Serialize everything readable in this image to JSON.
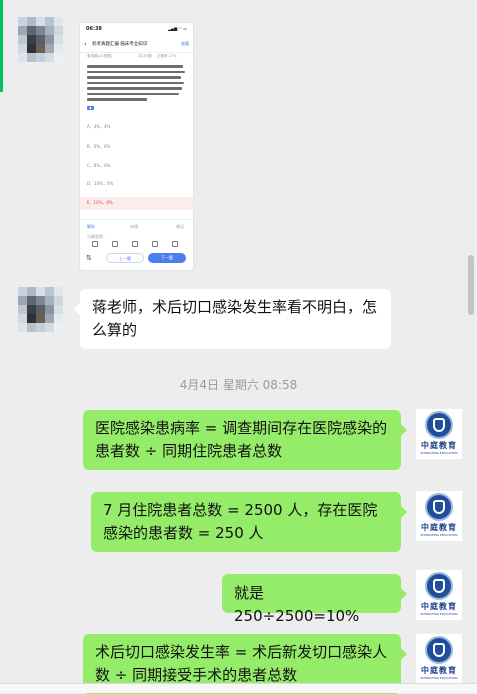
{
  "chat": {
    "timestamp": "4月4日 星期六 08:58"
  },
  "screenshot": {
    "status_time": "06:38",
    "status_icons": "▂▄▆ ◠ ▭",
    "nav_title": "机考真题汇编 临床专业知识",
    "nav_right": "收藏",
    "meta_left": "单选题(A1型题)",
    "meta_mid": "共100题",
    "meta_right": "正确率 27%",
    "options": [
      "A、4%，4%",
      "B、6%，6%",
      "C、8%，8%",
      "D、10%，4%",
      "E、10%，8%"
    ],
    "foot_a": "解析",
    "foot_b": "纠错",
    "foot_c": "笔记",
    "foot_d": "正确答案：",
    "btn_prev": "上一题",
    "btn_next": "下一题"
  },
  "messages": [
    {
      "side": "left",
      "text": "蒋老师，术后切口感染发生率看不明白，怎么算的"
    },
    {
      "side": "right",
      "text": "医院感染患病率 = 调查期间存在医院感染的患者数 ÷ 同期住院患者总数"
    },
    {
      "side": "right",
      "text": "7 月住院患者总数 = 2500 人，存在医院感染的患者数 = 250 人"
    },
    {
      "side": "right",
      "text": "就是250÷2500=10%"
    },
    {
      "side": "right",
      "text": "术后切口感染发生率 = 术后新发切口感染人数 ÷ 同期接受手术的患者总数"
    }
  ],
  "teacher_logo": {
    "name_cn": "中庭教育",
    "name_en": "ZHONGTING EDUCATION"
  },
  "colors": {
    "background": "#ededed",
    "green_bubble": "#95ec69",
    "white_bubble": "#ffffff",
    "logo_blue": "#1f4e9b",
    "accent_blue": "#4c7df0"
  }
}
